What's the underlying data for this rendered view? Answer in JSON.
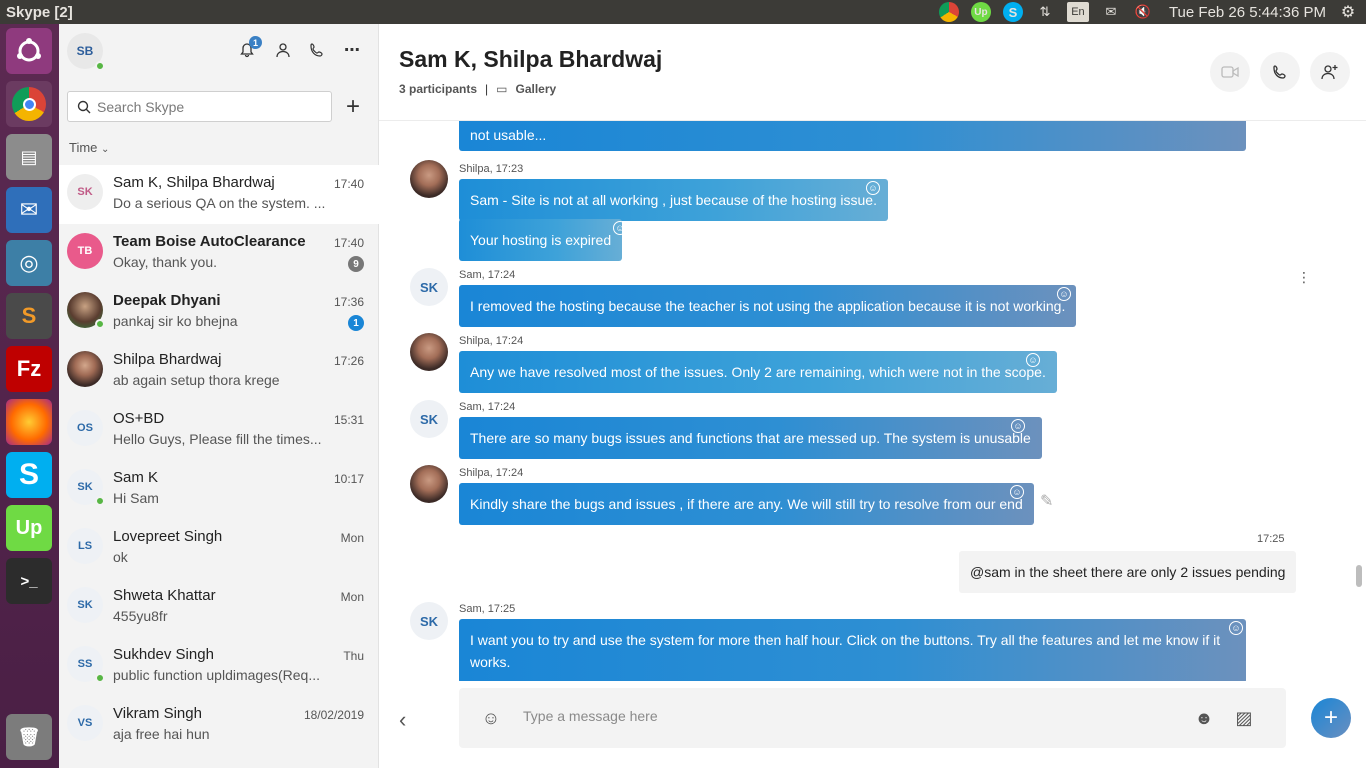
{
  "window": {
    "title": "Skype [2]"
  },
  "tray": {
    "clock": "Tue Feb 26  5:44:36 PM",
    "keyboard": "En"
  },
  "me": {
    "initials": "SB",
    "notifications": "1"
  },
  "search": {
    "placeholder": "Search Skype"
  },
  "sort": {
    "label": "Time"
  },
  "contacts": [
    {
      "initials": "SK",
      "name": "Sam K, Shilpa Bhardwaj",
      "preview": "Do a serious QA on the system. ...",
      "time": "17:40",
      "badge": ""
    },
    {
      "initials": "TB",
      "name": "Team Boise AutoClearance",
      "preview": "Okay, thank you.",
      "time": "17:40",
      "badge": "9"
    },
    {
      "initials": "",
      "name": "Deepak Dhyani",
      "preview": "pankaj sir ko bhejna",
      "time": "17:36",
      "badge": "1"
    },
    {
      "initials": "",
      "name": "Shilpa Bhardwaj",
      "preview": "ab again setup thora krege",
      "time": "17:26",
      "badge": ""
    },
    {
      "initials": "OS",
      "name": "OS+BD",
      "preview": "Hello Guys, Please fill the times...",
      "time": "15:31",
      "badge": ""
    },
    {
      "initials": "SK",
      "name": "Sam K",
      "preview": "Hi Sam",
      "time": "10:17",
      "badge": ""
    },
    {
      "initials": "LS",
      "name": "Lovepreet Singh",
      "preview": "ok",
      "time": "Mon",
      "badge": ""
    },
    {
      "initials": "SK",
      "name": "Shweta Khattar",
      "preview": "455yu8fr",
      "time": "Mon",
      "badge": ""
    },
    {
      "initials": "SS",
      "name": "Sukhdev Singh",
      "preview": " public function upldimages(Req...",
      "time": "Thu",
      "badge": ""
    },
    {
      "initials": "VS",
      "name": "Vikram Singh",
      "preview": "aja free hai hun",
      "time": "18/02/2019",
      "badge": ""
    }
  ],
  "chat": {
    "title": "Sam K, Shilpa Bhardwaj",
    "participants": "3 participants",
    "gallery": "Gallery",
    "messages": [
      {
        "text": "not usable..."
      },
      {
        "meta": "Shilpa, 17:23",
        "text": "Sam - Site is not at all working , just because of the hosting issue."
      },
      {
        "text": "Your hosting is expired"
      },
      {
        "meta": "Sam, 17:24",
        "text": "I removed the hosting because the teacher is not using the application because it is not working."
      },
      {
        "meta": "Shilpa, 17:24",
        "text": "Any we have resolved most of the issues. Only 2 are remaining, which were not in the scope."
      },
      {
        "meta": "Sam, 17:24",
        "text": "There are so many bugs issues and functions that are messed up. The system is unusable"
      },
      {
        "meta": "Shilpa, 17:24",
        "text": "Kindly share the bugs and issues , if there are any.  We will still try to resolve from our end"
      },
      {
        "meta": "17:25",
        "text": "@sam in the  sheet there are only 2 issues pending"
      },
      {
        "meta": "Sam, 17:25",
        "text": "I want you to try and use the system for more then half hour. Click on the buttons. Try all the features and let me know if it works."
      }
    ],
    "avatar_initials": "SK",
    "compose_placeholder": "Type a message here"
  }
}
